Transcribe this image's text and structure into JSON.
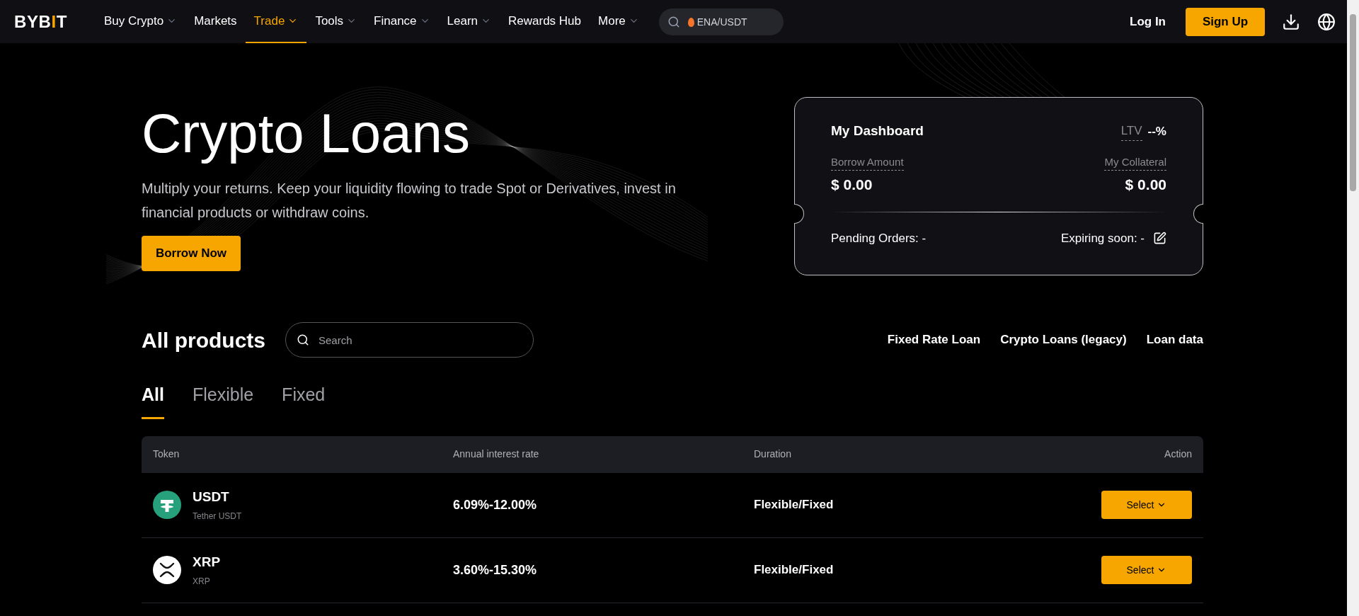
{
  "logo": {
    "lead": "BYB",
    "accent": "I",
    "tail": "T"
  },
  "nav": [
    {
      "label": "Buy Crypto",
      "dropdown": true,
      "selected": false
    },
    {
      "label": "Markets",
      "dropdown": false,
      "selected": false
    },
    {
      "label": "Trade",
      "dropdown": true,
      "selected": true
    },
    {
      "label": "Tools",
      "dropdown": true,
      "selected": false
    },
    {
      "label": "Finance",
      "dropdown": true,
      "selected": false
    },
    {
      "label": "Learn",
      "dropdown": true,
      "selected": false
    },
    {
      "label": "Rewards Hub",
      "dropdown": false,
      "selected": false
    },
    {
      "label": "More",
      "dropdown": true,
      "selected": false
    }
  ],
  "header_search": {
    "placeholder": "ENA/USDT"
  },
  "auth": {
    "login": "Log In",
    "signup": "Sign Up"
  },
  "hero": {
    "title": "Crypto Loans",
    "subtitle": "Multiply your returns. Keep your liquidity flowing to trade Spot or Derivatives, invest in financial products or withdraw coins.",
    "button": "Borrow Now"
  },
  "dashboard": {
    "title": "My Dashboard",
    "ltv_label": "LTV",
    "ltv_value": "--%",
    "borrow_label": "Borrow Amount",
    "borrow_value": "$ 0.00",
    "collateral_label": "My Collateral",
    "collateral_value": "$ 0.00",
    "pending": "Pending Orders: -",
    "expiring": "Expiring soon: -"
  },
  "products": {
    "title": "All products",
    "search": {
      "placeholder": "Search"
    },
    "links": [
      "Fixed Rate Loan",
      "Crypto Loans (legacy)",
      "Loan data"
    ]
  },
  "tabs": [
    {
      "label": "All",
      "selected": true
    },
    {
      "label": "Flexible",
      "selected": false
    },
    {
      "label": "Fixed",
      "selected": false
    }
  ],
  "table": {
    "columns": [
      "Token",
      "Annual interest rate",
      "Duration",
      "Action"
    ],
    "rows": [
      {
        "kind": "tether",
        "symbol": "USDT",
        "name": "Tether USDT",
        "rate": "6.09%-12.00%",
        "duration": "Flexible/Fixed",
        "action": "Select"
      },
      {
        "kind": "xrp",
        "symbol": "XRP",
        "name": "XRP",
        "rate": "3.60%-15.30%",
        "duration": "Flexible/Fixed",
        "action": "Select"
      }
    ]
  }
}
